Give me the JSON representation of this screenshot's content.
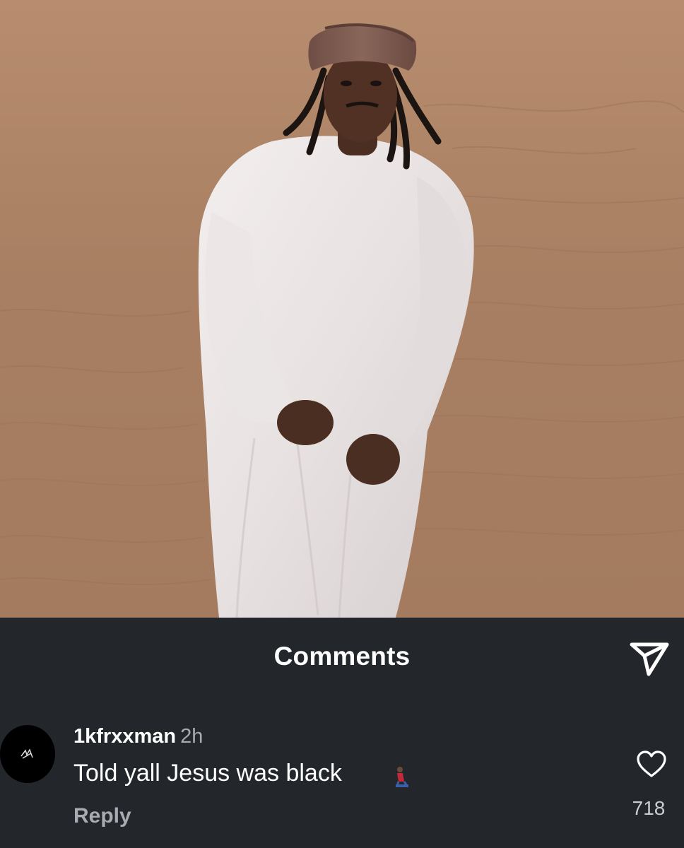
{
  "post": {
    "image_description_icon": "photo"
  },
  "comments_sheet": {
    "title": "Comments",
    "share_icon": "send-paper-plane-icon"
  },
  "comment": {
    "username": "1kfrxxman",
    "time": "2h",
    "text": "Told yall Jesus was black",
    "emoji": "person-kneeling-emoji",
    "reply_label": "Reply",
    "like_icon": "heart-outline-icon",
    "like_count": "718"
  },
  "colors": {
    "sheet_bg": "#23272c",
    "text_primary": "#ffffff",
    "text_secondary": "#a8acb1",
    "sand": "#ad8365"
  }
}
